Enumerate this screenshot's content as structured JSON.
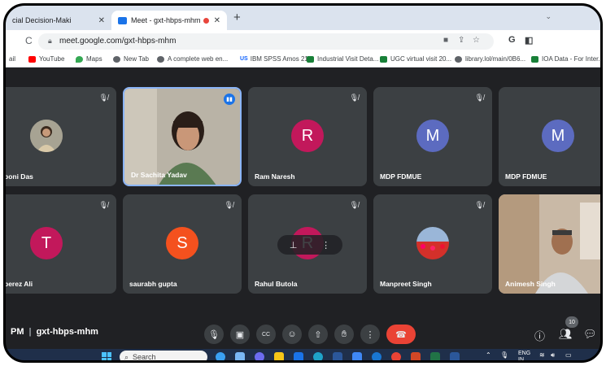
{
  "browser": {
    "tabs": [
      {
        "label": "cial Decision-Maki",
        "close": "✕"
      },
      {
        "label": "Meet - gxt-hbps-mhm",
        "close": "✕"
      }
    ],
    "new_tab": "+",
    "url": "meet.google.com/gxt-hbps-mhm",
    "profile_initial": "G"
  },
  "bookmarks": [
    {
      "label": "ail",
      "color": "#ea4335",
      "icon": "gmail-icon"
    },
    {
      "label": "YouTube",
      "color": "#ff0000",
      "icon": "youtube-icon"
    },
    {
      "label": "Maps",
      "color": "#34a853",
      "icon": "maps-icon"
    },
    {
      "label": "New Tab",
      "color": "#5f6368",
      "icon": "globe-icon"
    },
    {
      "label": "A complete web en...",
      "color": "#5f6368",
      "icon": "globe-icon"
    },
    {
      "label": "IBM SPSS Amos 21...",
      "color": "#0f62fe",
      "icon": "us-icon",
      "glyph": "US"
    },
    {
      "label": "Industrial Visit Deta...",
      "color": "#188038",
      "icon": "sheets-icon"
    },
    {
      "label": "UGC virtual visit 20...",
      "color": "#188038",
      "icon": "sheets-icon"
    },
    {
      "label": "library.lol/main/0B6...",
      "color": "#5f6368",
      "icon": "globe-icon"
    },
    {
      "label": "IOA Data - For Inter...",
      "color": "#188038",
      "icon": "sheets-icon"
    }
  ],
  "participants": [
    {
      "name": "boni Das",
      "type": "photo",
      "muted": true
    },
    {
      "name": "Dr Sachita Yadav",
      "type": "video",
      "muted": false,
      "speaking": true
    },
    {
      "name": "Ram Naresh",
      "type": "initial",
      "initial": "R",
      "color": "#c2185b",
      "muted": true
    },
    {
      "name": "MDP FDMUE",
      "type": "initial",
      "initial": "M",
      "color": "#5c6bc0",
      "muted": true
    },
    {
      "name": "MDP FDMUE",
      "type": "initial",
      "initial": "M",
      "color": "#5c6bc0",
      "muted": true
    },
    {
      "name": "berez Ali",
      "type": "initial",
      "initial": "T",
      "color": "#c2185b",
      "muted": true
    },
    {
      "name": "saurabh gupta",
      "type": "initial",
      "initial": "S",
      "color": "#f4511e",
      "muted": true
    },
    {
      "name": "Rahul Butola",
      "type": "initial",
      "initial": "R",
      "color": "#c2185b",
      "muted": true,
      "hover": true
    },
    {
      "name": "Manpreet Singh",
      "type": "photo",
      "muted": true
    },
    {
      "name": "Animesh Singh",
      "type": "video",
      "muted": false
    }
  ],
  "meeting": {
    "time": "PM",
    "code": "gxt-hbps-mhm",
    "participant_count": "10"
  },
  "taskbar": {
    "search_placeholder": "Search",
    "lang": "ENG",
    "lang2": "IN"
  }
}
